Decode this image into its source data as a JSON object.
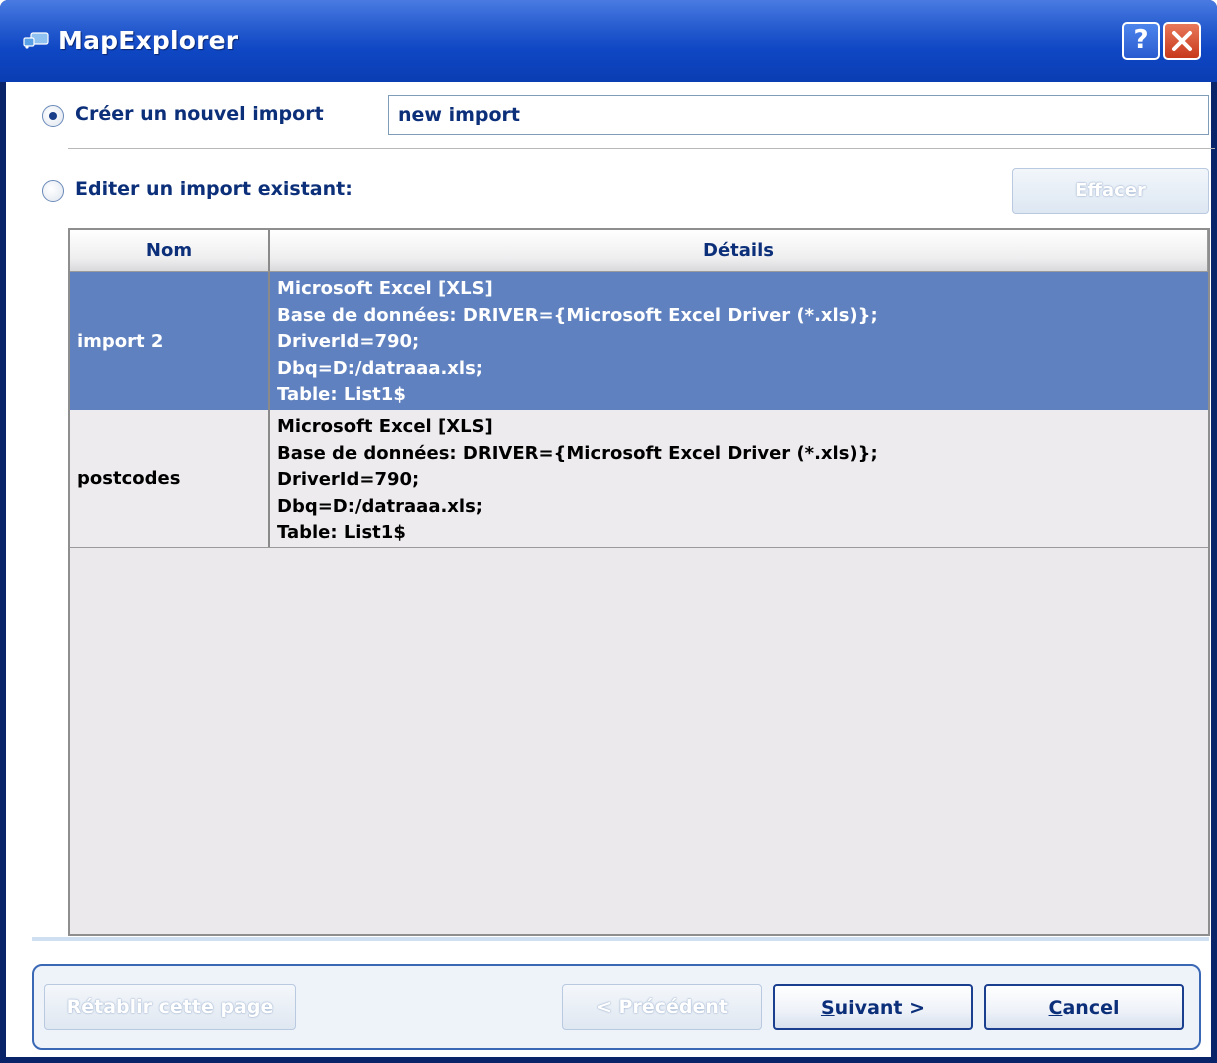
{
  "window": {
    "title": "MapExplorer",
    "help_glyph": "?",
    "close_glyph": "✕"
  },
  "create": {
    "label": "Créer un nouvel import",
    "selected": true,
    "name_value": "new import"
  },
  "edit": {
    "label": "Editer un import existant:",
    "selected": false,
    "delete_label": "Effacer"
  },
  "table": {
    "columns": [
      "Nom",
      "Détails"
    ],
    "rows": [
      {
        "name": "import 2",
        "selected": true,
        "details": [
          "Microsoft Excel [XLS]",
          "Base de données: DRIVER={Microsoft Excel Driver (*.xls)};",
          "DriverId=790;",
          "Dbq=D:/datraaa.xls;",
          "Table: List1$"
        ]
      },
      {
        "name": "postcodes",
        "selected": false,
        "details": [
          "Microsoft Excel [XLS]",
          "Base de données: DRIVER={Microsoft Excel Driver (*.xls)};",
          "DriverId=790;",
          "Dbq=D:/datraaa.xls;",
          "Table: List1$"
        ]
      }
    ]
  },
  "footer": {
    "reset_label": "Rétablir cette page",
    "previous_label": "< Précédent",
    "next_label": "Suivant >",
    "cancel_label": "Cancel"
  },
  "colors": {
    "title_bar": "#0f47c4",
    "selection": "#6081bf",
    "label_text": "#0c2f7a"
  }
}
